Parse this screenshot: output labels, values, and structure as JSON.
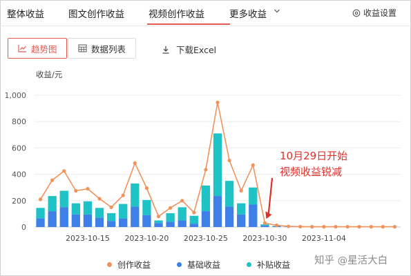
{
  "tabs": [
    {
      "label": "整体收益"
    },
    {
      "label": "图文创作收益"
    },
    {
      "label": "视频创作收益"
    },
    {
      "label": "更多收益"
    }
  ],
  "settings_label": "收益设置",
  "view_buttons": {
    "trend": "趋势图",
    "list": "数据列表"
  },
  "download_label": "下载Excel",
  "unit_label": "收益/元",
  "legend": [
    {
      "label": "创作收益",
      "color": "#f0925c"
    },
    {
      "label": "基础收益",
      "color": "#3f7fe8"
    },
    {
      "label": "补贴收益",
      "color": "#1fc3c6"
    }
  ],
  "watermark": "知乎 @星活大白",
  "chart_data": {
    "type": "bar",
    "stacked": true,
    "ylim": [
      0,
      1000
    ],
    "yticks": [
      "0",
      "200",
      "400",
      "600",
      "800",
      "1,000"
    ],
    "grid": true,
    "legend_position": "bottom",
    "x": [
      "2023-10-11",
      "2023-10-12",
      "2023-10-13",
      "2023-10-14",
      "2023-10-15",
      "2023-10-16",
      "2023-10-17",
      "2023-10-18",
      "2023-10-19",
      "2023-10-20",
      "2023-10-21",
      "2023-10-22",
      "2023-10-23",
      "2023-10-24",
      "2023-10-25",
      "2023-10-26",
      "2023-10-27",
      "2023-10-28",
      "2023-10-29",
      "2023-10-30",
      "2023-10-31",
      "2023-11-01",
      "2023-11-02",
      "2023-11-03",
      "2023-11-04",
      "2023-11-05",
      "2023-11-06",
      "2023-11-07",
      "2023-11-08",
      "2023-11-09",
      "2023-11-10"
    ],
    "xtick_labels": [
      "2023-10-15",
      "2023-10-20",
      "2023-10-25",
      "2023-10-30",
      "2023-11-04"
    ],
    "series": [
      {
        "name": "基础收益",
        "type": "bar",
        "values": [
          65,
          120,
          150,
          95,
          95,
          70,
          45,
          65,
          155,
          90,
          30,
          40,
          50,
          25,
          120,
          235,
          155,
          95,
          170,
          10,
          5,
          2,
          1,
          1,
          1,
          1,
          1,
          1,
          1,
          1,
          1
        ]
      },
      {
        "name": "补贴收益",
        "type": "bar",
        "values": [
          145,
          235,
          275,
          180,
          195,
          145,
          105,
          175,
          330,
          205,
          50,
          105,
          150,
          85,
          315,
          710,
          350,
          180,
          300,
          20,
          8,
          3,
          2,
          1,
          1,
          1,
          1,
          1,
          1,
          1,
          1
        ]
      },
      {
        "name": "创作收益",
        "type": "line",
        "values": [
          210,
          355,
          425,
          275,
          290,
          215,
          150,
          240,
          485,
          295,
          80,
          145,
          200,
          110,
          435,
          945,
          505,
          275,
          470,
          30,
          13,
          5,
          3,
          2,
          2,
          2,
          2,
          2,
          2,
          2,
          2
        ]
      }
    ],
    "annotations": [
      {
        "text_lines": [
          "10月29日开始",
          "视频收益锐减"
        ],
        "color": "#e0302b"
      }
    ]
  }
}
